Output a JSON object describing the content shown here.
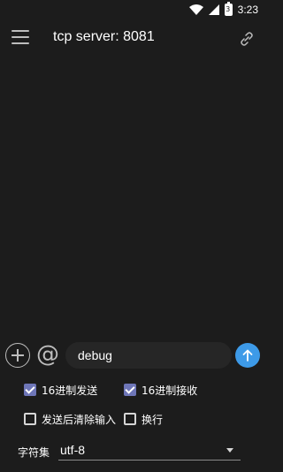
{
  "status_bar": {
    "battery_level": "3",
    "time": "3:23"
  },
  "toolbar": {
    "title": "tcp server: 8081",
    "menu_icon": "hamburger-menu-icon",
    "link_icon": "link-icon"
  },
  "composer": {
    "add_icon": "plus-circle-icon",
    "at_symbol": "@",
    "input_value": "debug",
    "send_icon": "send-arrow-icon",
    "send_color": "#3d9ae8"
  },
  "options": {
    "hex_send": {
      "label": "16进制发送",
      "checked": true
    },
    "hex_receive": {
      "label": "16进制接收",
      "checked": true
    },
    "clear_after_send": {
      "label": "发送后清除输入",
      "checked": false
    },
    "newline": {
      "label": "换行",
      "checked": false
    }
  },
  "charset": {
    "label": "字符集",
    "value": "utf-8"
  },
  "colors": {
    "background": "#1c1c1c",
    "checkbox_checked": "#6e76b8"
  }
}
